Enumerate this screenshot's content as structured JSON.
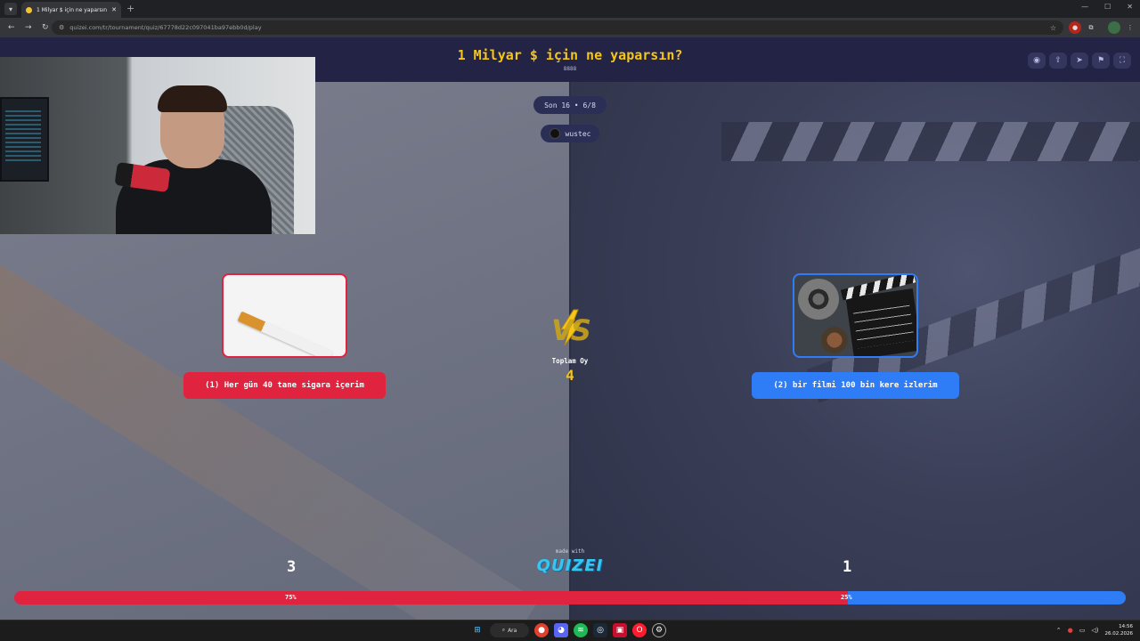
{
  "browser": {
    "tab_title": "1 Milyar $ için ne yaparsın? - Ti",
    "new_tab_label": "+",
    "url": "quizei.com/tr/tournament/quiz/67778d22c097041ba97ebb0d/play"
  },
  "page": {
    "title": "1 Milyar $ için ne yaparsın?",
    "subtitle": "8888",
    "round_label": "Son 16 • 6/8",
    "username": "wustec"
  },
  "header_icons": [
    "eye-icon",
    "share-icon",
    "send-icon",
    "flag-icon",
    "fullscreen-icon"
  ],
  "left_choice": {
    "label": "(1) Her gün 40 tane sigara içerim",
    "votes": "3",
    "percent": "75%",
    "percent_value": 75,
    "color": "#e0233f"
  },
  "right_choice": {
    "label": "(2) bir filmi 100 bin kere izlerim",
    "votes": "1",
    "percent": "25%",
    "percent_value": 25,
    "color": "#2f7df6"
  },
  "center": {
    "vs": "VS",
    "total_label": "Toplam Oy",
    "total_value": "4",
    "made_with": "made with",
    "logo": "QUIZEI"
  },
  "taskbar": {
    "search_label": "Ara",
    "time": "14:56",
    "date": "26.02.2026"
  },
  "colors": {
    "accent_yellow": "#f5c518",
    "header_bg": "#232346"
  }
}
